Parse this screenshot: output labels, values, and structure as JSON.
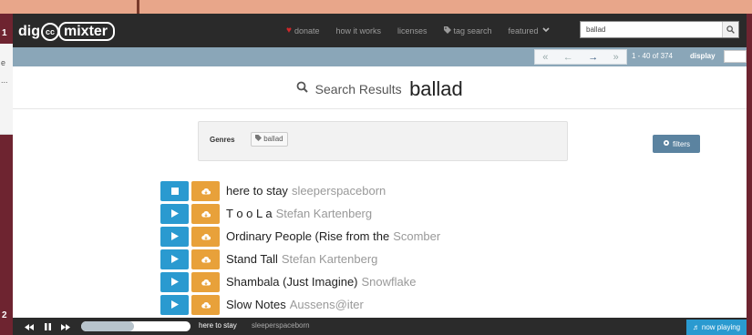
{
  "desktop": {
    "left_numbers": [
      "1",
      "2"
    ],
    "left_fragments": [
      "e",
      "..."
    ]
  },
  "nav": {
    "logo": {
      "prefix": "dig",
      "cc": "cc",
      "suffix": "mixter"
    },
    "links": [
      {
        "label": "donate",
        "icon": "heart-icon"
      },
      {
        "label": "how it works"
      },
      {
        "label": "licenses"
      },
      {
        "label": "tag search",
        "icon": "tag-icon"
      },
      {
        "label": "featured",
        "icon": "chevron-down-icon"
      }
    ],
    "search_value": "ballad"
  },
  "pagination": {
    "buttons": [
      "«",
      "←",
      "→",
      "»"
    ],
    "range_text": "1 - 40 of 374",
    "display_label": "display"
  },
  "results": {
    "label": "Search Results",
    "term": "ballad"
  },
  "genres": {
    "label": "Genres",
    "tag": "ballad"
  },
  "filters_label": "filters",
  "tracks": [
    {
      "title": "here to stay",
      "artist": "sleeperspaceborn",
      "playing": true
    },
    {
      "title": "T o o L a",
      "artist": "Stefan Kartenberg",
      "playing": false
    },
    {
      "title": "Ordinary People (Rise from the",
      "artist": "Scomber",
      "playing": false
    },
    {
      "title": "Stand Tall",
      "artist": "Stefan Kartenberg",
      "playing": false
    },
    {
      "title": "Shambala (Just Imagine)",
      "artist": "Snowflake",
      "playing": false
    },
    {
      "title": "Slow Notes",
      "artist": "Aussens@iter",
      "playing": false
    }
  ],
  "player": {
    "title": "here to stay",
    "artist": "sleeperspaceborn",
    "progress": 0.48,
    "now_playing_label": "now playing"
  },
  "colors": {
    "nav_bg": "#2a2a2a",
    "pagebar_bg": "#8aa6b8",
    "play_button": "#2a9ad0",
    "download_button": "#e8a13a",
    "filters_button": "#5b83a0",
    "donate_heart": "#d0282a"
  }
}
